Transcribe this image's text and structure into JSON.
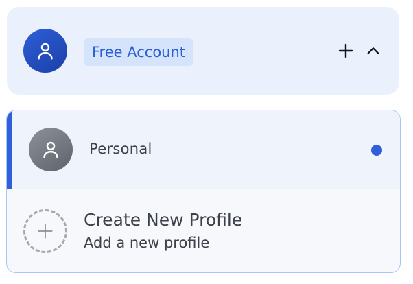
{
  "account": {
    "badge_label": "Free Account",
    "avatar_icon": "user-icon",
    "add_icon": "plus-icon",
    "collapse_icon": "chevron-up-icon"
  },
  "profiles": [
    {
      "name": "Personal",
      "avatar_icon": "user-icon",
      "active": true
    }
  ],
  "create_profile": {
    "title": "Create New Profile",
    "subtitle": "Add a new profile",
    "icon": "plus-icon"
  },
  "colors": {
    "accent": "#2f5fd9",
    "header_bg": "#eaf1fd",
    "badge_bg": "#d5e3fb",
    "badge_text": "#2a5fd6",
    "dropdown_border": "#a9c6f2"
  }
}
